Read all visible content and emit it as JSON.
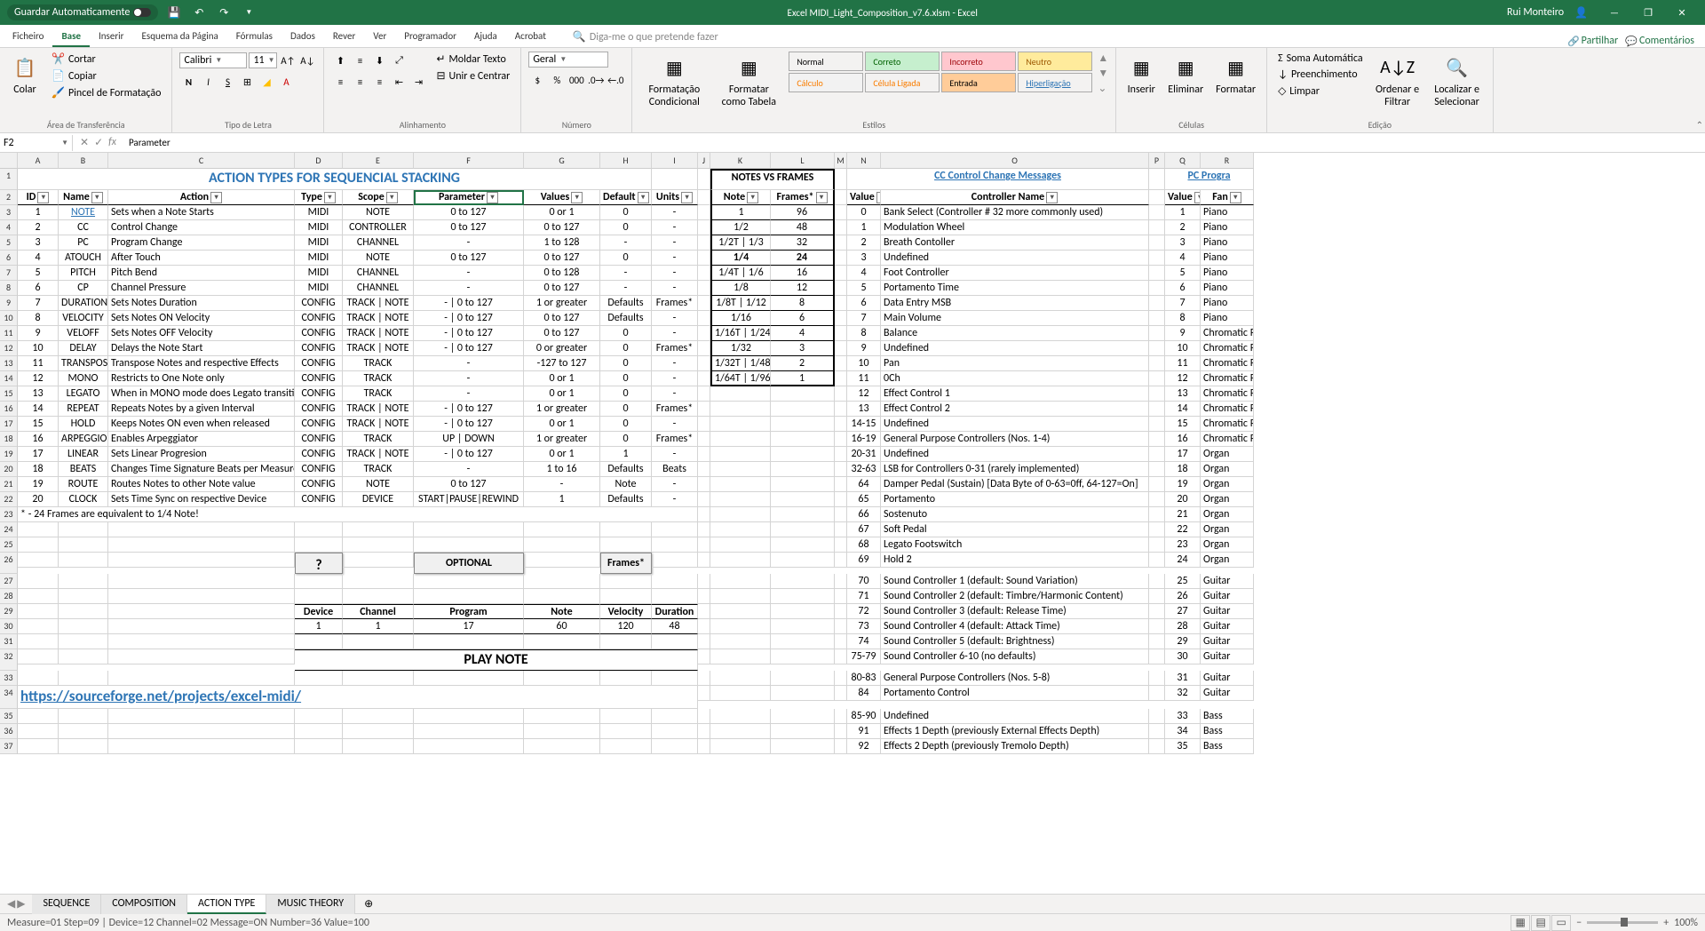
{
  "title": "Excel MIDI_Light_Composition_v7.6.xlsm - Excel",
  "user": "Rui Monteiro",
  "auto_save": "Guardar Automaticamente",
  "menus": [
    "Ficheiro",
    "Base",
    "Inserir",
    "Esquema da Página",
    "Fórmulas",
    "Dados",
    "Rever",
    "Ver",
    "Programador",
    "Ajuda",
    "Acrobat"
  ],
  "active_menu": 1,
  "tell_me": "Diga-me o que pretende fazer",
  "share": "Partilhar",
  "comments": "Comentários",
  "ribbon": {
    "clipboard": {
      "label": "Área de Transferência",
      "paste": "Colar",
      "cut": "Cortar",
      "copy": "Copiar",
      "format": "Pincel de Formatação"
    },
    "font": {
      "label": "Tipo de Letra",
      "name": "Calibri",
      "size": "11"
    },
    "align": {
      "label": "Alinhamento",
      "wrap": "Moldar Texto",
      "merge": "Unir e Centrar"
    },
    "number": {
      "label": "Número",
      "format": "Geral"
    },
    "styles": {
      "label": "Estilos",
      "cond": "Formatação Condicional",
      "table": "Formatar como Tabela",
      "normal": "Normal",
      "correct": "Correto",
      "incorrect": "Incorreto",
      "neutral": "Neutro",
      "calc": "Cálculo",
      "linked": "Célula Ligada",
      "input": "Entrada",
      "hyper": "Hiperligação"
    },
    "cells": {
      "label": "Células",
      "insert": "Inserir",
      "delete": "Eliminar",
      "format": "Formatar"
    },
    "editing": {
      "label": "Edição",
      "sum": "Soma Automática",
      "fill": "Preenchimento",
      "clear": "Limpar",
      "sort": "Ordenar e Filtrar",
      "find": "Localizar e Selecionar"
    }
  },
  "name_box": "F2",
  "formula": "Parameter",
  "cols": [
    "",
    "A",
    "B",
    "C",
    "D",
    "E",
    "F",
    "G",
    "H",
    "I",
    "J",
    "K",
    "L",
    "M",
    "N",
    "O",
    "P",
    "Q",
    "R"
  ],
  "title1": "ACTION TYPES FOR SEQUENCIAL STACKING",
  "title2": "NOTES VS FRAMES",
  "title3": "CC Control Change Messages",
  "title4": "PC Progra",
  "headers1": [
    "ID",
    "Name",
    "Action",
    "Type",
    "Scope",
    "Parameter",
    "Values",
    "Default",
    "Units"
  ],
  "headers2": [
    "Note",
    "Frames*"
  ],
  "headers3": [
    "Value",
    "Controller Name"
  ],
  "headers4": [
    "Value",
    "Fan"
  ],
  "actions": [
    [
      1,
      "NOTE",
      "Sets when a Note Starts",
      "MIDI",
      "NOTE",
      "0 to 127",
      "0 or 1",
      "0",
      "-"
    ],
    [
      2,
      "CC",
      "Control Change",
      "MIDI",
      "CONTROLLER",
      "0 to 127",
      "0 to 127",
      "0",
      "-"
    ],
    [
      3,
      "PC",
      "Program Change",
      "MIDI",
      "CHANNEL",
      "-",
      "1 to 128",
      "-",
      "-"
    ],
    [
      4,
      "ATOUCH",
      "After Touch",
      "MIDI",
      "NOTE",
      "0 to 127",
      "0 to 127",
      "0",
      "-"
    ],
    [
      5,
      "PITCH",
      "Pitch Bend",
      "MIDI",
      "CHANNEL",
      "-",
      "0 to 128",
      "-",
      "-"
    ],
    [
      6,
      "CP",
      "Channel Pressure",
      "MIDI",
      "CHANNEL",
      "-",
      "0 to 127",
      "-",
      "-"
    ],
    [
      7,
      "DURATION",
      "Sets Notes Duration",
      "CONFIG",
      "TRACK | NOTE",
      "- | 0 to 127",
      "1 or greater",
      "Defaults",
      "Frames*"
    ],
    [
      8,
      "VELOCITY",
      "Sets Notes ON Velocity",
      "CONFIG",
      "TRACK | NOTE",
      "- | 0 to 127",
      "0 to 127",
      "Defaults",
      "-"
    ],
    [
      9,
      "VELOFF",
      "Sets Notes OFF Velocity",
      "CONFIG",
      "TRACK | NOTE",
      "- | 0 to 127",
      "0 to 127",
      "0",
      "-"
    ],
    [
      10,
      "DELAY",
      "Delays the Note Start",
      "CONFIG",
      "TRACK | NOTE",
      "- | 0 to 127",
      "0 or greater",
      "0",
      "Frames*"
    ],
    [
      11,
      "TRANSPOSE",
      "Transpose Notes and respective Effects",
      "CONFIG",
      "TRACK",
      "-",
      "-127 to 127",
      "0",
      "-"
    ],
    [
      12,
      "MONO",
      "Restricts to One Note only",
      "CONFIG",
      "TRACK",
      "-",
      "0 or 1",
      "0",
      "-"
    ],
    [
      13,
      "LEGATO",
      "When in MONO mode does Legato transition",
      "CONFIG",
      "TRACK",
      "-",
      "0 or 1",
      "0",
      "-"
    ],
    [
      14,
      "REPEAT",
      "Repeats Notes by a given Interval",
      "CONFIG",
      "TRACK | NOTE",
      "- | 0 to 127",
      "1 or greater",
      "0",
      "Frames*"
    ],
    [
      15,
      "HOLD",
      "Keeps Notes ON even when released",
      "CONFIG",
      "TRACK | NOTE",
      "- | 0 to 127",
      "0 or 1",
      "0",
      "-"
    ],
    [
      16,
      "ARPEGGIO",
      "Enables Arpeggiator",
      "CONFIG",
      "TRACK",
      "UP | DOWN",
      "1 or greater",
      "0",
      "Frames*"
    ],
    [
      17,
      "LINEAR",
      "Sets Linear Progresion",
      "CONFIG",
      "TRACK | NOTE",
      "- | 0 to 127",
      "0 or 1",
      "1",
      "-"
    ],
    [
      18,
      "BEATS",
      "Changes Time Signature Beats per Measure",
      "CONFIG",
      "TRACK",
      "-",
      "1 to 16",
      "Defaults",
      "Beats"
    ],
    [
      19,
      "ROUTE",
      "Routes Notes to other Note value",
      "CONFIG",
      "NOTE",
      "0 to 127",
      "-",
      "Note",
      "-"
    ],
    [
      20,
      "CLOCK",
      "Sets Time Sync on respective Device",
      "CONFIG",
      "DEVICE",
      "START|PAUSE|REWIND",
      "1",
      "Defaults",
      "-"
    ]
  ],
  "footnote": "* - 24 Frames are equivalent to 1/4 Note!",
  "notes_frames": [
    [
      "1",
      "96"
    ],
    [
      "1/2",
      "48"
    ],
    [
      "1/2T | 1/3",
      "32"
    ],
    [
      "1/4",
      "24"
    ],
    [
      "1/4T | 1/6",
      "16"
    ],
    [
      "1/8",
      "12"
    ],
    [
      "1/8T | 1/12",
      "8"
    ],
    [
      "1/16",
      "6"
    ],
    [
      "1/16T | 1/24",
      "4"
    ],
    [
      "1/32",
      "3"
    ],
    [
      "1/32T | 1/48",
      "2"
    ],
    [
      "1/64T | 1/96",
      "1"
    ]
  ],
  "cc": [
    [
      "0",
      "Bank Select (Controller # 32 more commonly used)"
    ],
    [
      "1",
      "Modulation Wheel"
    ],
    [
      "2",
      "Breath Contoller"
    ],
    [
      "3",
      "Undefined"
    ],
    [
      "4",
      "Foot Controller"
    ],
    [
      "5",
      "Portamento Time"
    ],
    [
      "6",
      "Data Entry MSB"
    ],
    [
      "7",
      "Main Volume"
    ],
    [
      "8",
      "Balance"
    ],
    [
      "9",
      "Undefined"
    ],
    [
      "10",
      "Pan"
    ],
    [
      "11",
      "0Ch"
    ],
    [
      "12",
      "Effect Control 1"
    ],
    [
      "13",
      "Effect Control 2"
    ],
    [
      "14-15",
      "Undefined"
    ],
    [
      "16-19",
      "General Purpose Controllers (Nos. 1-4)"
    ],
    [
      "20-31",
      "Undefined"
    ],
    [
      "32-63",
      "LSB for Controllers 0-31 (rarely implemented)"
    ],
    [
      "64",
      "Damper Pedal (Sustain) [Data Byte of 0-63=0ff, 64-127=On]"
    ],
    [
      "65",
      "Portamento"
    ],
    [
      "66",
      "Sostenuto"
    ],
    [
      "67",
      "Soft Pedal"
    ],
    [
      "68",
      "Legato Footswitch"
    ],
    [
      "69",
      "Hold 2"
    ],
    [
      "70",
      "Sound Controller 1 (default: Sound Variation)"
    ],
    [
      "71",
      "Sound Controller 2 (default: Timbre/Harmonic Content)"
    ],
    [
      "72",
      "Sound Controller 3 (default: Release Time)"
    ],
    [
      "73",
      "Sound Controller 4 (default: Attack Time)"
    ],
    [
      "74",
      "Sound Controller 5 (default: Brightness)"
    ],
    [
      "75-79",
      "Sound Controller 6-10 (no defaults)"
    ],
    [
      "80-83",
      "General Purpose Controllers (Nos. 5-8)"
    ],
    [
      "84",
      "Portamento Control"
    ],
    [
      "85-90",
      "Undefined"
    ],
    [
      "91",
      "Effects 1 Depth (previously External Effects Depth)"
    ],
    [
      "92",
      "Effects 2 Depth (previously Tremolo Depth)"
    ]
  ],
  "pc": [
    [
      "1",
      "Piano"
    ],
    [
      "2",
      "Piano"
    ],
    [
      "3",
      "Piano"
    ],
    [
      "4",
      "Piano"
    ],
    [
      "5",
      "Piano"
    ],
    [
      "6",
      "Piano"
    ],
    [
      "7",
      "Piano"
    ],
    [
      "8",
      "Piano"
    ],
    [
      "9",
      "Chromatic P"
    ],
    [
      "10",
      "Chromatic P"
    ],
    [
      "11",
      "Chromatic P"
    ],
    [
      "12",
      "Chromatic P"
    ],
    [
      "13",
      "Chromatic P"
    ],
    [
      "14",
      "Chromatic P"
    ],
    [
      "15",
      "Chromatic P"
    ],
    [
      "16",
      "Chromatic P"
    ],
    [
      "17",
      "Organ"
    ],
    [
      "18",
      "Organ"
    ],
    [
      "19",
      "Organ"
    ],
    [
      "20",
      "Organ"
    ],
    [
      "21",
      "Organ"
    ],
    [
      "22",
      "Organ"
    ],
    [
      "23",
      "Organ"
    ],
    [
      "24",
      "Organ"
    ],
    [
      "25",
      "Guitar"
    ],
    [
      "26",
      "Guitar"
    ],
    [
      "27",
      "Guitar"
    ],
    [
      "28",
      "Guitar"
    ],
    [
      "29",
      "Guitar"
    ],
    [
      "30",
      "Guitar"
    ],
    [
      "31",
      "Guitar"
    ],
    [
      "32",
      "Guitar"
    ],
    [
      "33",
      "Bass"
    ],
    [
      "34",
      "Bass"
    ],
    [
      "35",
      "Bass"
    ]
  ],
  "qmark": "?",
  "optional": "OPTIONAL",
  "frames_btn": "Frames*",
  "example_headers": [
    "Device",
    "Channel",
    "Program",
    "Note",
    "Velocity",
    "Duration"
  ],
  "example_vals": [
    "1",
    "1",
    "17",
    "60",
    "120",
    "48"
  ],
  "play_note": "PLAY NOTE",
  "link": "https://sourceforge.net/projects/excel-midi/",
  "tabs": [
    "SEQUENCE",
    "COMPOSITION",
    "ACTION TYPE",
    "MUSIC THEORY"
  ],
  "active_tab": 2,
  "status": "Measure=01 Step=09 | Device=12 Channel=02 Message=ON  Number=36 Value=100",
  "zoom": "100%"
}
